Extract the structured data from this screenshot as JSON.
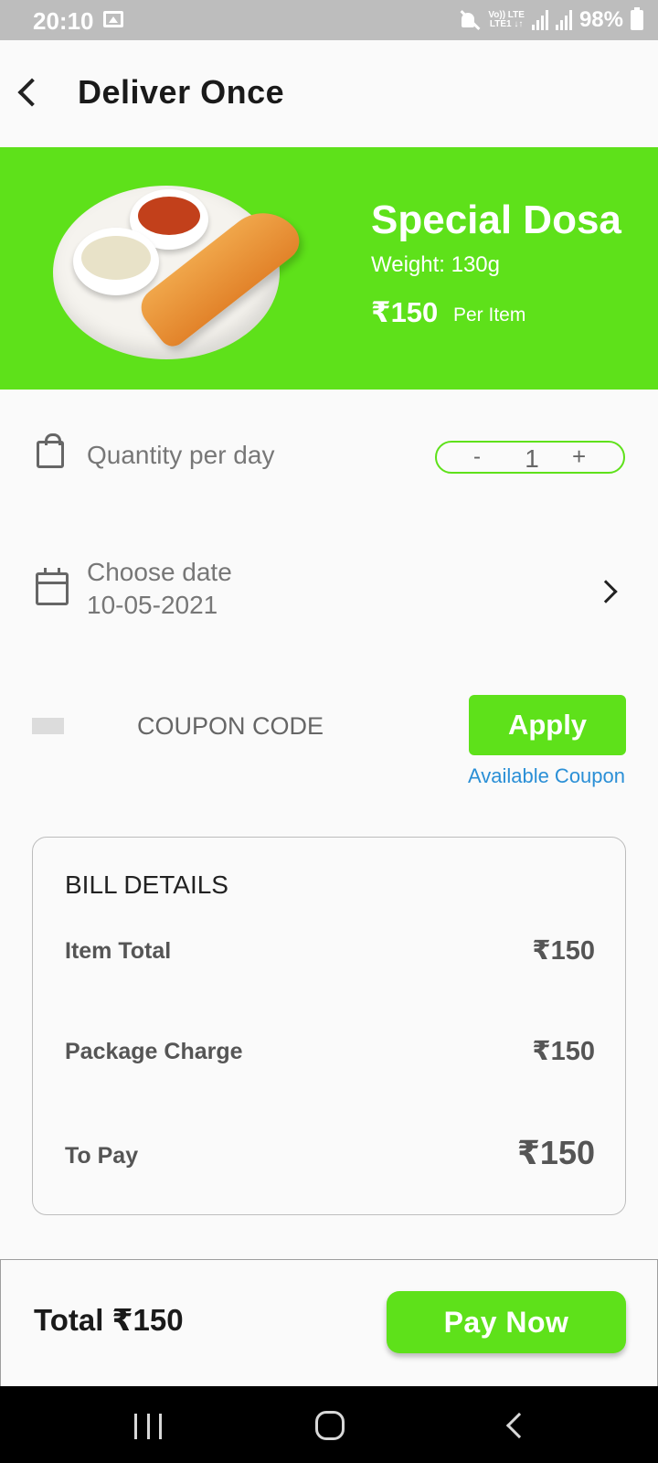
{
  "status_bar": {
    "time": "20:10",
    "network_top": "Vo)) LTE",
    "network_bottom": "LTE1 ↓↑",
    "battery": "98%"
  },
  "header": {
    "title": "Deliver Once",
    "back_icon": "back-arrow-icon"
  },
  "product": {
    "name": "Special Dosa",
    "weight": "Weight: 130g",
    "price": "₹150",
    "unit": "Per Item",
    "image": "dosa-plate-image"
  },
  "quantity": {
    "label": "Quantity per day",
    "minus": "-",
    "value": "1",
    "plus": "+"
  },
  "date": {
    "label": "Choose date",
    "value": "10-05-2021"
  },
  "coupon": {
    "placeholder": "COUPON CODE",
    "apply_label": "Apply",
    "available_label": "Available Coupon"
  },
  "bill": {
    "title": "BILL DETAILS",
    "lines": [
      {
        "label": "Item Total",
        "amount": "₹150"
      },
      {
        "label": "Package Charge",
        "amount": "₹150"
      },
      {
        "label": "To Pay",
        "amount": "₹150"
      }
    ]
  },
  "footer": {
    "total_text": "Total ₹150",
    "pay_label": "Pay Now"
  },
  "colors": {
    "accent": "#5ee11a",
    "link": "#2a8fd6",
    "status_bar": "#bdbdbd",
    "nav_bar": "#000000"
  }
}
